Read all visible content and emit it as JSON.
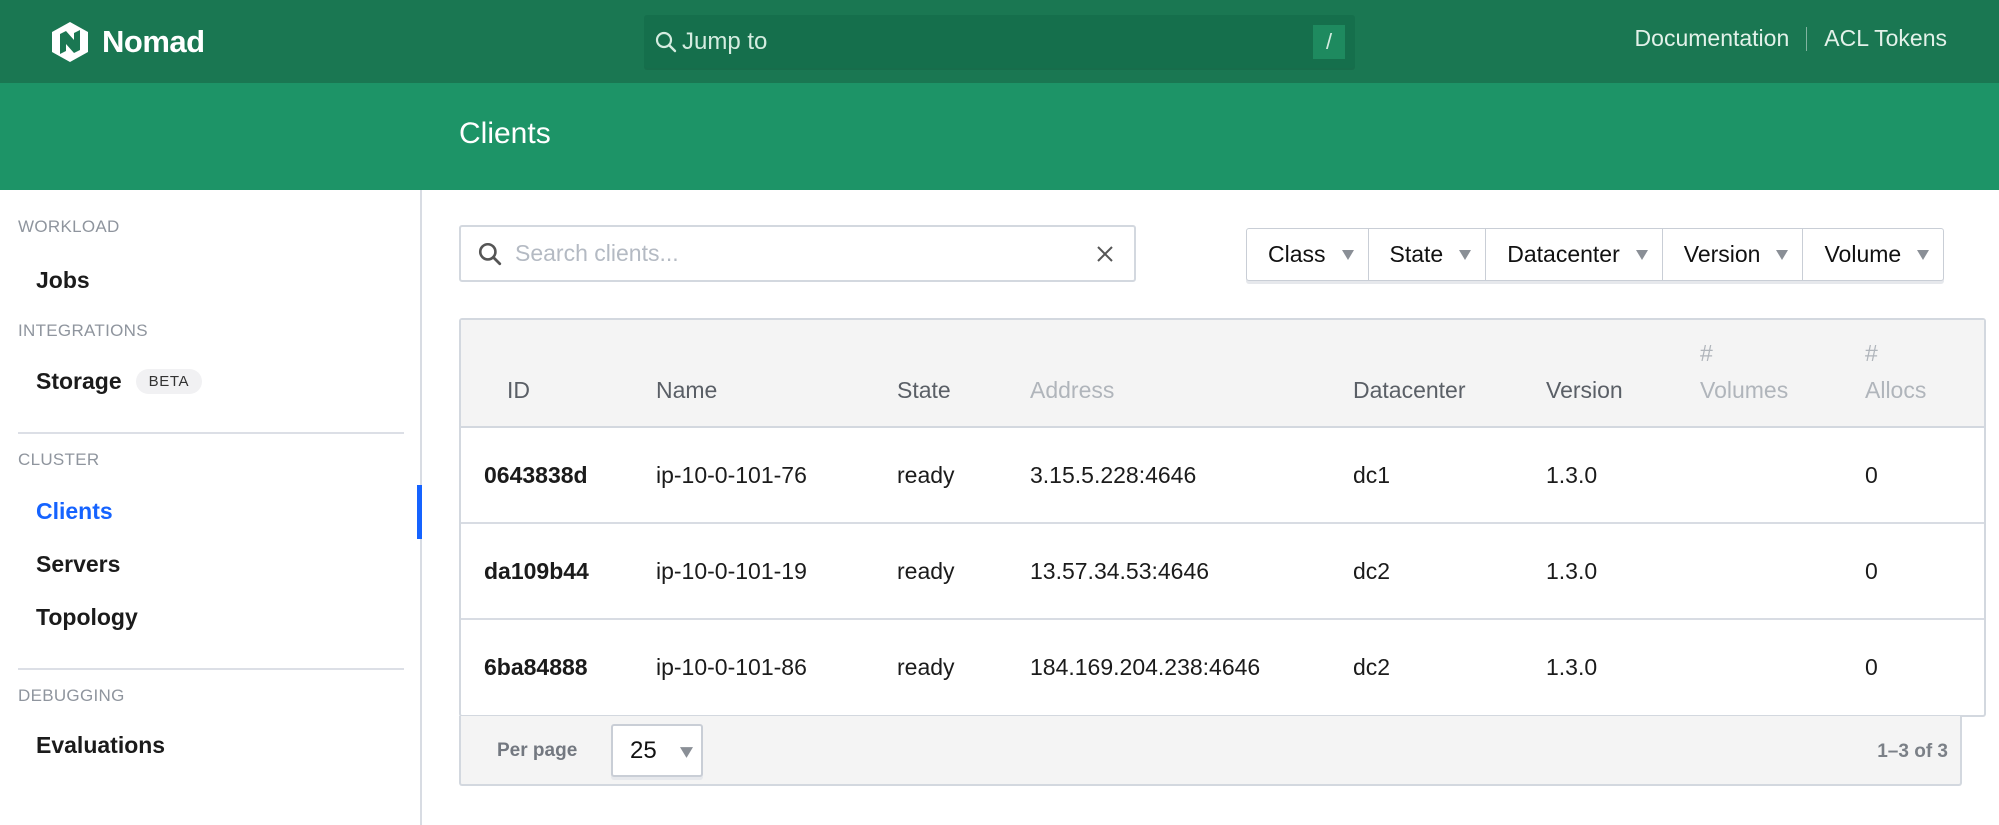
{
  "app": {
    "name": "Nomad",
    "brand_color": "#1a7752",
    "accent_color": "#1563ff"
  },
  "header": {
    "jump_placeholder": "Jump to",
    "jump_shortcut": "/",
    "links": [
      {
        "label": "Documentation"
      },
      {
        "label": "ACL Tokens"
      }
    ]
  },
  "page": {
    "title": "Clients"
  },
  "sidebar": {
    "sections": [
      {
        "label": "WORKLOAD",
        "items": [
          {
            "label": "Jobs"
          }
        ]
      },
      {
        "label": "INTEGRATIONS",
        "items": [
          {
            "label": "Storage",
            "badge": "BETA"
          }
        ]
      },
      {
        "label": "CLUSTER",
        "items": [
          {
            "label": "Clients",
            "active": true
          },
          {
            "label": "Servers"
          },
          {
            "label": "Topology"
          }
        ]
      },
      {
        "label": "DEBUGGING",
        "items": [
          {
            "label": "Evaluations"
          }
        ]
      }
    ]
  },
  "search": {
    "placeholder": "Search clients...",
    "value": ""
  },
  "filters": [
    {
      "label": "Class"
    },
    {
      "label": "State"
    },
    {
      "label": "Datacenter"
    },
    {
      "label": "Version"
    },
    {
      "label": "Volume"
    }
  ],
  "table": {
    "columns": [
      {
        "label": "ID"
      },
      {
        "label": "Name"
      },
      {
        "label": "State"
      },
      {
        "label": "Address"
      },
      {
        "label": "Datacenter"
      },
      {
        "label": "Version"
      },
      {
        "hash": "#",
        "label": "Volumes"
      },
      {
        "hash": "#",
        "label": "Allocs"
      }
    ],
    "rows": [
      {
        "id": "0643838d",
        "name": "ip-10-0-101-76",
        "state": "ready",
        "address": "3.15.5.228:4646",
        "datacenter": "dc1",
        "version": "1.3.0",
        "volumes": "",
        "allocs": "0"
      },
      {
        "id": "da109b44",
        "name": "ip-10-0-101-19",
        "state": "ready",
        "address": "13.57.34.53:4646",
        "datacenter": "dc2",
        "version": "1.3.0",
        "volumes": "",
        "allocs": "0"
      },
      {
        "id": "6ba84888",
        "name": "ip-10-0-101-86",
        "state": "ready",
        "address": "184.169.204.238:4646",
        "datacenter": "dc2",
        "version": "1.3.0",
        "volumes": "",
        "allocs": "0"
      }
    ]
  },
  "pagination": {
    "per_page_label": "Per page",
    "per_page_value": "25",
    "info": "1–3 of 3"
  }
}
